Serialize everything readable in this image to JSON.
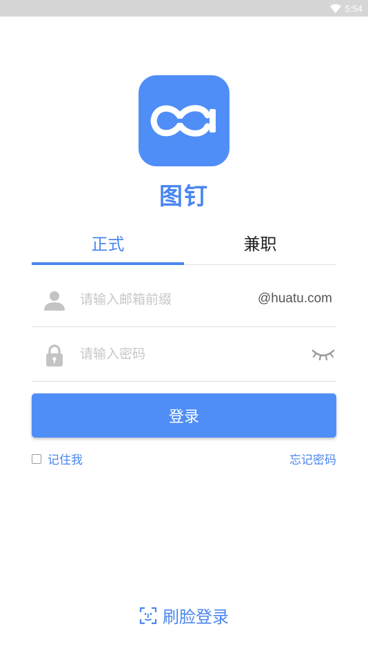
{
  "status_bar": {
    "time": "5:54",
    "icon": "wifi-icon"
  },
  "app": {
    "name": "图钉",
    "logo_icon": "infinity-logo-icon"
  },
  "tabs": [
    {
      "label": "正式",
      "active": true
    },
    {
      "label": "兼职",
      "active": false
    }
  ],
  "email_field": {
    "placeholder": "请输入邮箱前缀",
    "value": "",
    "suffix": "@huatu.com",
    "icon": "user-icon"
  },
  "password_field": {
    "placeholder": "请输入密码",
    "value": "",
    "icon": "lock-icon",
    "toggle_icon": "eye-closed-icon"
  },
  "login_button": {
    "label": "登录"
  },
  "remember": {
    "label": "记住我",
    "checked": false
  },
  "forgot_password": {
    "label": "忘记密码"
  },
  "face_login": {
    "label": "刷脸登录",
    "icon": "face-scan-icon"
  },
  "colors": {
    "accent": "#4a86f0",
    "button": "#4f8ef7",
    "status_bar": "#d6d6d6"
  }
}
